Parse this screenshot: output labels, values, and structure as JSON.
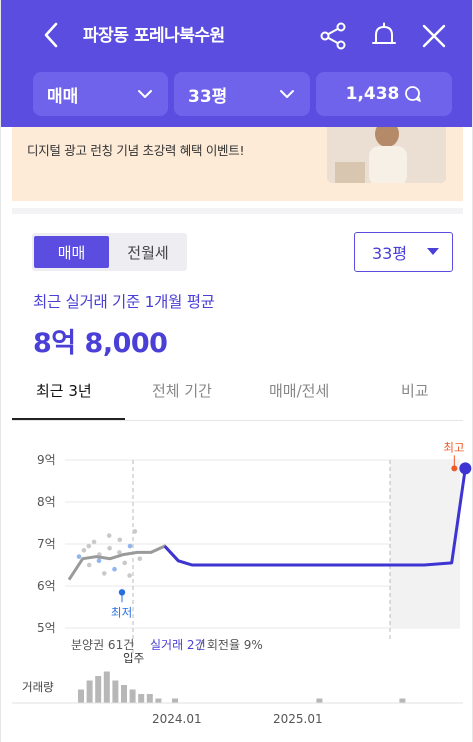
{
  "header": {
    "title": "파장동 포레나북수원",
    "icons": [
      "back-icon",
      "share-icon",
      "bell-icon",
      "close-icon"
    ],
    "filters": [
      {
        "label": "매매",
        "icon": "chevron-down-icon"
      },
      {
        "label": "33평",
        "icon": "chevron-down-icon"
      },
      {
        "label": "1,438",
        "icon": "chat-icon"
      }
    ]
  },
  "banner": {
    "text": "디지털 광고 런칭 기념 초강력 혜택 이벤트!",
    "bg": "#fdebd8"
  },
  "toggle": {
    "options": [
      "매매",
      "전월세"
    ],
    "selected": "매매"
  },
  "size_select": {
    "value": "33평"
  },
  "summary": {
    "label": "최근 실거래 기준 1개월 평균",
    "price": "8억 8,000"
  },
  "tabs": [
    {
      "label": "최근 3년",
      "active": true
    },
    {
      "label": "전체 기간",
      "active": false
    },
    {
      "label": "매매/전세",
      "active": false
    },
    {
      "label": "비교",
      "active": false
    }
  ],
  "colors": {
    "accent": "#5a4de0",
    "price": "#4a3fd6",
    "high": "#ef5a2a",
    "low": "#2a6fe0"
  },
  "chart_data": {
    "type": "line",
    "ylabel": "",
    "yticks": [
      "9억",
      "8억",
      "7억",
      "6억",
      "5억"
    ],
    "ylim": [
      5,
      9
    ],
    "xticks": [
      "2024.01",
      "2025.01"
    ],
    "grid": true,
    "series": [
      {
        "values": [
          {
            "x": "2023.04",
            "y": 6.15
          },
          {
            "x": "2023.05",
            "y": 6.65
          },
          {
            "x": "2023.06",
            "y": 6.7
          },
          {
            "x": "2023.07",
            "y": 6.65
          },
          {
            "x": "2023.08",
            "y": 6.75
          },
          {
            "x": "2023.09",
            "y": 6.8
          },
          {
            "x": "2023.10",
            "y": 6.8
          },
          {
            "x": "2023.11",
            "y": 6.95
          },
          {
            "x": "2023.12",
            "y": 6.6
          },
          {
            "x": "2024.01",
            "y": 6.5
          },
          {
            "x": "2024.06",
            "y": 6.5
          },
          {
            "x": "2025.01",
            "y": 6.5
          },
          {
            "x": "2025.06",
            "y": 6.5
          },
          {
            "x": "2025.08",
            "y": 6.55
          },
          {
            "x": "2025.09",
            "y": 8.8
          }
        ]
      }
    ],
    "markers": {
      "high_label": "최고",
      "low_label": "최저",
      "move_in_label": "입주"
    },
    "legend": {
      "pre_sale": "분양권 61건",
      "trades": "실거래 2건",
      "turnover": "/ 회전율 9%"
    },
    "volume_label": "거래량",
    "volume": [
      3,
      5,
      6,
      7,
      5,
      4,
      3,
      2,
      2,
      1,
      1,
      0,
      0,
      0,
      1,
      0,
      0,
      0,
      0,
      1
    ]
  }
}
